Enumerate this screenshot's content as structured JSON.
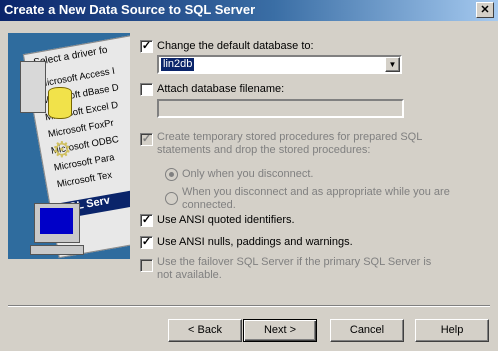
{
  "window": {
    "title": "Create a New Data Source to SQL Server",
    "close_glyph": "✕"
  },
  "illustration": {
    "header": "Select a driver fo",
    "drivers": [
      "Microsoft Access I",
      "Microsoft dBase D",
      "Microsoft Excel D",
      "Microsoft FoxPr",
      "Microsoft ODBC",
      "Microsoft Para",
      "Microsoft Tex"
    ],
    "selected": "SQL Serv"
  },
  "options": {
    "change_default_db": {
      "label": "Change the default database to:",
      "checked": true
    },
    "default_db_value": "lin2db",
    "attach_filename": {
      "label": "Attach database filename:",
      "checked": false
    },
    "create_temp_procs": {
      "label": "Create temporary stored procedures for prepared SQL statements and drop the stored procedures:",
      "checked": true,
      "disabled": true
    },
    "radio_disconnect": {
      "label": "Only when you disconnect.",
      "selected": true
    },
    "radio_disconnect_appropriate": {
      "label": "When you disconnect and as appropriate while you are connected.",
      "selected": false
    },
    "ansi_quoted": {
      "label": "Use ANSI quoted identifiers.",
      "checked": true
    },
    "ansi_nulls": {
      "label": "Use ANSI nulls, paddings and warnings.",
      "checked": true
    },
    "failover": {
      "label": "Use the failover SQL Server if the primary SQL Server is not available.",
      "checked": false,
      "disabled": true
    }
  },
  "buttons": {
    "back": "< Back",
    "next": "Next >",
    "cancel": "Cancel",
    "help": "Help"
  }
}
